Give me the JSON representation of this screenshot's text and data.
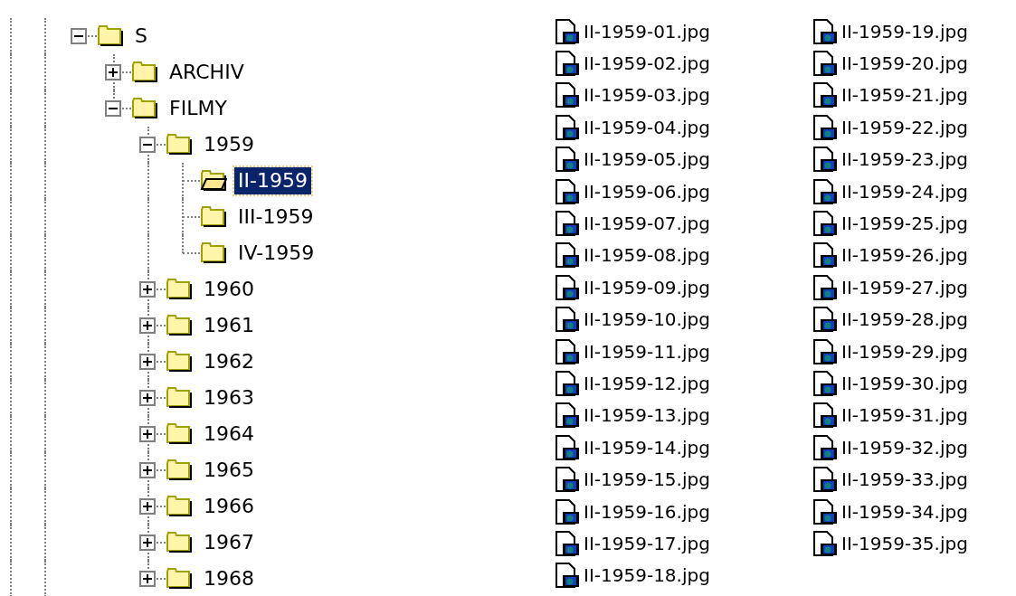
{
  "tree": [
    {
      "label": "S",
      "expanded": true,
      "selected": false,
      "children": [
        {
          "label": "ARCHIV",
          "expanded": false,
          "selected": false
        },
        {
          "label": "FILMY",
          "expanded": true,
          "selected": false,
          "children": [
            {
              "label": "1959",
              "expanded": true,
              "selected": false,
              "children": [
                {
                  "label": "II-1959",
                  "selected": true
                },
                {
                  "label": "III-1959",
                  "selected": false
                },
                {
                  "label": "IV-1959",
                  "selected": false
                }
              ]
            },
            {
              "label": "1960",
              "expanded": false,
              "selected": false
            },
            {
              "label": "1961",
              "expanded": false,
              "selected": false
            },
            {
              "label": "1962",
              "expanded": false,
              "selected": false
            },
            {
              "label": "1963",
              "expanded": false,
              "selected": false
            },
            {
              "label": "1964",
              "expanded": false,
              "selected": false
            },
            {
              "label": "1965",
              "expanded": false,
              "selected": false
            },
            {
              "label": "1966",
              "expanded": false,
              "selected": false
            },
            {
              "label": "1967",
              "expanded": false,
              "selected": false
            },
            {
              "label": "1968",
              "expanded": false,
              "selected": false
            }
          ]
        }
      ]
    }
  ],
  "files": [
    "II-1959-01.jpg",
    "II-1959-02.jpg",
    "II-1959-03.jpg",
    "II-1959-04.jpg",
    "II-1959-05.jpg",
    "II-1959-06.jpg",
    "II-1959-07.jpg",
    "II-1959-08.jpg",
    "II-1959-09.jpg",
    "II-1959-10.jpg",
    "II-1959-11.jpg",
    "II-1959-12.jpg",
    "II-1959-13.jpg",
    "II-1959-14.jpg",
    "II-1959-15.jpg",
    "II-1959-16.jpg",
    "II-1959-17.jpg",
    "II-1959-18.jpg",
    "II-1959-19.jpg",
    "II-1959-20.jpg",
    "II-1959-21.jpg",
    "II-1959-22.jpg",
    "II-1959-23.jpg",
    "II-1959-24.jpg",
    "II-1959-25.jpg",
    "II-1959-26.jpg",
    "II-1959-27.jpg",
    "II-1959-28.jpg",
    "II-1959-29.jpg",
    "II-1959-30.jpg",
    "II-1959-31.jpg",
    "II-1959-32.jpg",
    "II-1959-33.jpg",
    "II-1959-34.jpg",
    "II-1959-35.jpg"
  ]
}
